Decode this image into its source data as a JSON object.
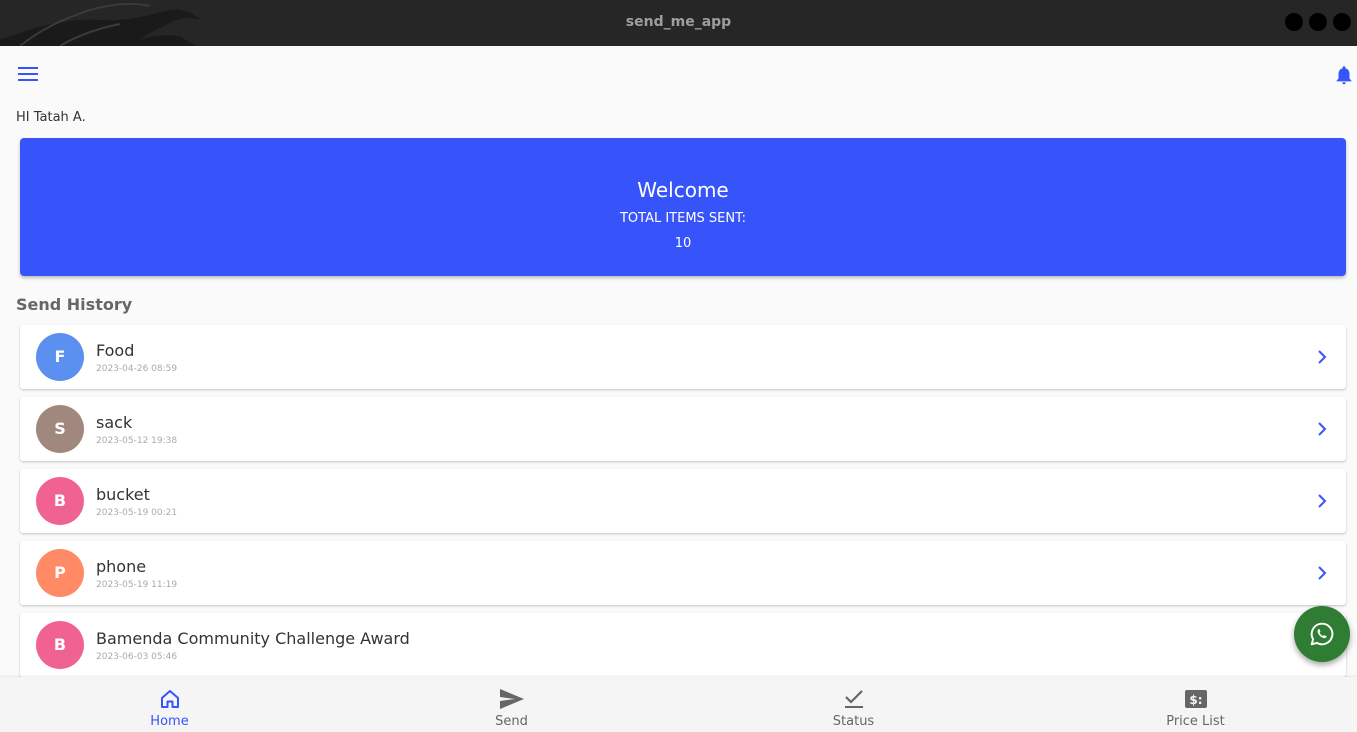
{
  "window": {
    "title": "send_me_app"
  },
  "appbar": {
    "menu_icon": "menu-icon",
    "bell_icon": "bell-icon"
  },
  "greeting": "HI Tatah A.",
  "welcome": {
    "title": "Welcome",
    "subtitle": "TOTAL ITEMS SENT:",
    "count": "10",
    "color": "#3754fb"
  },
  "history": {
    "title": "Send History",
    "items": [
      {
        "initial": "F",
        "name": "Food",
        "date": "2023-04-26 08:59",
        "color": "#5b8ff0"
      },
      {
        "initial": "S",
        "name": "sack",
        "date": "2023-05-12 19:38",
        "color": "#a1887f"
      },
      {
        "initial": "B",
        "name": "bucket",
        "date": "2023-05-19 00:21",
        "color": "#f06292"
      },
      {
        "initial": "P",
        "name": "phone",
        "date": "2023-05-19 11:19",
        "color": "#ff8a65"
      },
      {
        "initial": "B",
        "name": "Bamenda Community Challenge Award",
        "date": "2023-06-03 05:46",
        "color": "#f06292"
      }
    ]
  },
  "fab": {
    "icon": "whatsapp-icon",
    "color": "#2e7d32"
  },
  "nav": {
    "items": [
      {
        "label": "Home",
        "icon": "home-icon",
        "active": true
      },
      {
        "label": "Send",
        "icon": "send-icon",
        "active": false
      },
      {
        "label": "Status",
        "icon": "check-icon",
        "active": false
      },
      {
        "label": "Price List",
        "icon": "price-list-icon",
        "active": false
      }
    ]
  }
}
